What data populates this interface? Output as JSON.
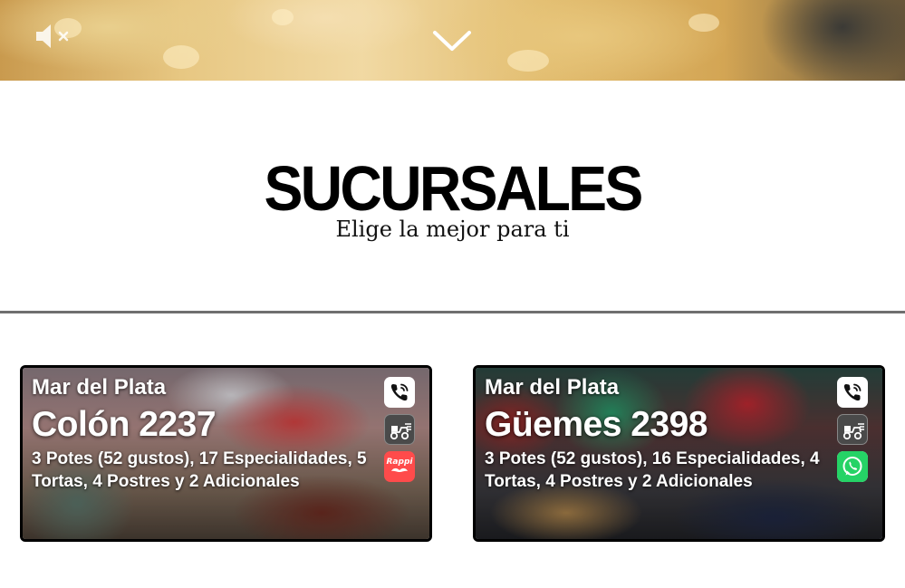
{
  "section": {
    "title": "SUCURSALES",
    "subtitle": "Elige la mejor para ti"
  },
  "hero": {
    "mute_icon": "speaker-muted-icon",
    "scroll_icon": "chevron-down-icon"
  },
  "branches": [
    {
      "city": "Mar del Plata",
      "address": "Colón 2237",
      "details": "3 Potes (52 gustos), 17 Especialidades, 5 Tortas, 4 Postres y 2 Adicionales",
      "icons": [
        "phone-icon",
        "delivery-icon",
        "rappi-icon"
      ],
      "rappi_label": "Rappi"
    },
    {
      "city": "Mar del Plata",
      "address": "Güemes 2398",
      "details": "3 Potes (52 gustos), 16 Especialidades, 4 Tortas, 4 Postres y 2 Adicionales",
      "icons": [
        "phone-icon",
        "delivery-icon",
        "whatsapp-icon"
      ]
    }
  ],
  "colors": {
    "divider": "#6f6f6f",
    "rappi": "#ff4b4b",
    "whatsapp": "#25d366"
  }
}
